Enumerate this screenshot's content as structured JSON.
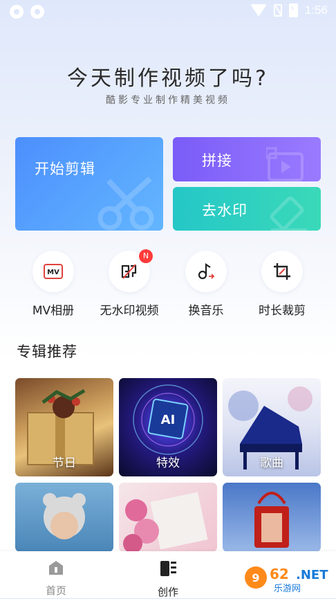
{
  "status_bar": {
    "time": "1:56"
  },
  "hero": {
    "title": "今天制作视频了吗?",
    "subtitle": "酷影专业制作精美视频"
  },
  "cards": {
    "main": "开始剪辑",
    "join": "拼接",
    "watermark": "去水印"
  },
  "tools": [
    {
      "label": "MV相册",
      "icon": "mv-album-icon"
    },
    {
      "label": "无水印视频",
      "icon": "no-watermark-icon",
      "badge": "N"
    },
    {
      "label": "换音乐",
      "icon": "music-change-icon"
    },
    {
      "label": "时长裁剪",
      "icon": "crop-icon"
    }
  ],
  "section": {
    "title": "专辑推荐"
  },
  "albums": [
    {
      "label": "节日"
    },
    {
      "label": "特效"
    },
    {
      "label": "歌曲"
    },
    {
      "label": ""
    },
    {
      "label": ""
    },
    {
      "label": ""
    }
  ],
  "nav": {
    "home": "首页",
    "create": "创作"
  },
  "watermark_logo": "962.NET 乐游网",
  "colors": {
    "primary": "#4c8ffd",
    "join": "#7a5cf8",
    "watermark": "#25c7c7",
    "badge": "#ff3b3b"
  }
}
